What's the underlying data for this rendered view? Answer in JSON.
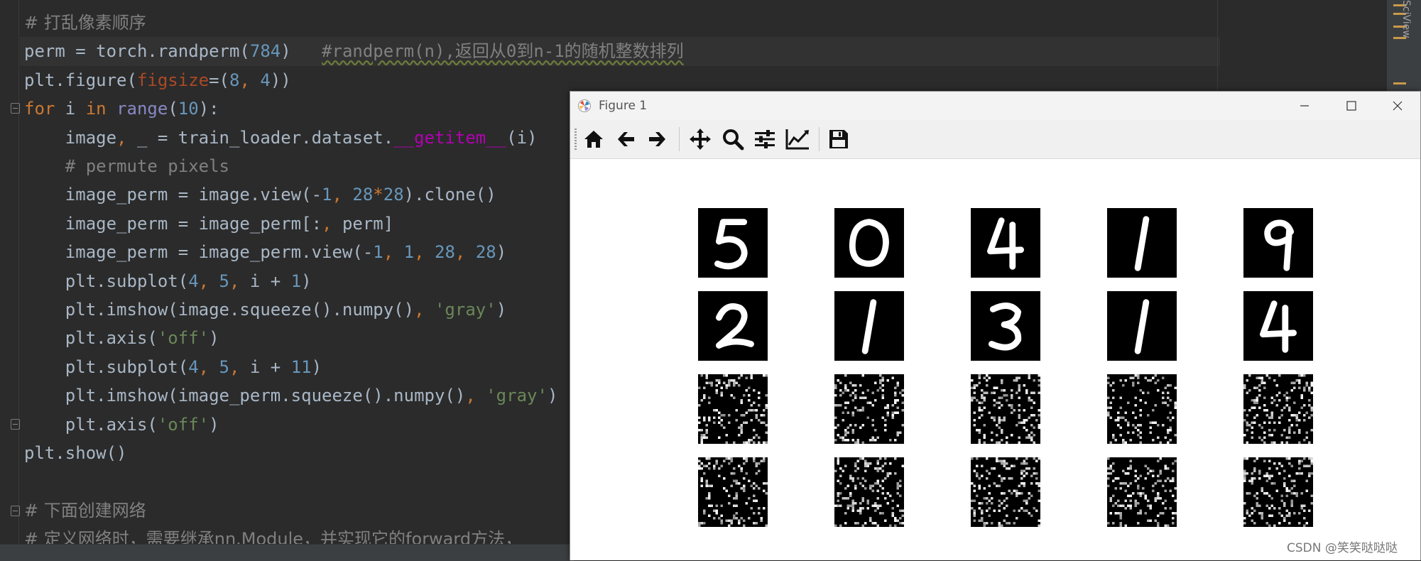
{
  "editor": {
    "lines": [
      [
        {
          "t": "# 打乱像素顺序",
          "c": "cm cm-cjk"
        }
      ],
      [
        {
          "t": "perm = torch.randperm("
        },
        {
          "t": "784",
          "c": "num"
        },
        {
          "t": ")   "
        },
        {
          "t": "#randperm(n),返回从0到n-1的随机整数排列",
          "c": "doc"
        }
      ],
      [
        {
          "t": "plt.figure("
        },
        {
          "t": "figsize",
          "c": "par"
        },
        {
          "t": "=("
        },
        {
          "t": "8",
          "c": "num"
        },
        {
          "t": ", ",
          "c": "kw"
        },
        {
          "t": "4",
          "c": "num"
        },
        {
          "t": "))"
        }
      ],
      [
        {
          "t": "for",
          "c": "kw"
        },
        {
          "t": " i "
        },
        {
          "t": "in",
          "c": "kw"
        },
        {
          "t": " "
        },
        {
          "t": "range",
          "c": "bi"
        },
        {
          "t": "("
        },
        {
          "t": "10",
          "c": "num"
        },
        {
          "t": "):"
        }
      ],
      [
        {
          "t": "    image"
        },
        {
          "t": ",",
          "c": "kw"
        },
        {
          "t": " _ = train_loader.dataset."
        },
        {
          "t": "__getitem__",
          "c": "dun"
        },
        {
          "t": "(i)"
        }
      ],
      [
        {
          "t": "    # permute pixels",
          "c": "cm"
        }
      ],
      [
        {
          "t": "    image_perm = image.view(-"
        },
        {
          "t": "1",
          "c": "num"
        },
        {
          "t": ", ",
          "c": "kw"
        },
        {
          "t": "28",
          "c": "num"
        },
        {
          "t": "*",
          "c": "kw"
        },
        {
          "t": "28",
          "c": "num"
        },
        {
          "t": ").clone()"
        }
      ],
      [
        {
          "t": "    image_perm = image_perm[:"
        },
        {
          "t": ", ",
          "c": "kw"
        },
        {
          "t": "perm]"
        }
      ],
      [
        {
          "t": "    image_perm = image_perm.view(-"
        },
        {
          "t": "1",
          "c": "num"
        },
        {
          "t": ", ",
          "c": "kw"
        },
        {
          "t": "1",
          "c": "num"
        },
        {
          "t": ", ",
          "c": "kw"
        },
        {
          "t": "28",
          "c": "num"
        },
        {
          "t": ", ",
          "c": "kw"
        },
        {
          "t": "28",
          "c": "num"
        },
        {
          "t": ")"
        }
      ],
      [
        {
          "t": "    plt.subplot("
        },
        {
          "t": "4",
          "c": "num"
        },
        {
          "t": ", ",
          "c": "kw"
        },
        {
          "t": "5",
          "c": "num"
        },
        {
          "t": ", ",
          "c": "kw"
        },
        {
          "t": "i + "
        },
        {
          "t": "1",
          "c": "num"
        },
        {
          "t": ")"
        }
      ],
      [
        {
          "t": "    plt.imshow(image.squeeze().numpy()"
        },
        {
          "t": ", ",
          "c": "kw"
        },
        {
          "t": "'gray'",
          "c": "str"
        },
        {
          "t": ")"
        }
      ],
      [
        {
          "t": "    plt.axis("
        },
        {
          "t": "'off'",
          "c": "str"
        },
        {
          "t": ")"
        }
      ],
      [
        {
          "t": "    plt.subplot("
        },
        {
          "t": "4",
          "c": "num"
        },
        {
          "t": ", ",
          "c": "kw"
        },
        {
          "t": "5",
          "c": "num"
        },
        {
          "t": ", ",
          "c": "kw"
        },
        {
          "t": "i + "
        },
        {
          "t": "11",
          "c": "num"
        },
        {
          "t": ")"
        }
      ],
      [
        {
          "t": "    plt.imshow(image_perm.squeeze().numpy()"
        },
        {
          "t": ", ",
          "c": "kw"
        },
        {
          "t": "'gray'",
          "c": "str"
        },
        {
          "t": ")"
        }
      ],
      [
        {
          "t": "    plt.axis("
        },
        {
          "t": "'off'",
          "c": "str"
        },
        {
          "t": ")"
        }
      ],
      [
        {
          "t": "plt.show()"
        }
      ],
      [],
      [
        {
          "t": "# 下面创建网络",
          "c": "cm cm-cjk"
        }
      ],
      [
        {
          "t": "# 定义网络时，需要继承nn.Module，并实现它的forward方法，",
          "c": "cm cm-cjk"
        }
      ]
    ],
    "side_panel_label": "SciView"
  },
  "figure_window": {
    "title": "Figure 1",
    "toolbar": [
      "home-icon",
      "back-icon",
      "forward-icon",
      "pan-icon",
      "zoom-icon",
      "configure-subplots-icon",
      "edit-axes-icon",
      "save-icon"
    ],
    "digits_row1": [
      "5",
      "0",
      "4",
      "1",
      "9"
    ],
    "digits_row2": [
      "2",
      "1",
      "3",
      "1",
      "4"
    ],
    "permuted_rows": 2
  },
  "watermark": "CSDN @笑笑哒哒哒"
}
